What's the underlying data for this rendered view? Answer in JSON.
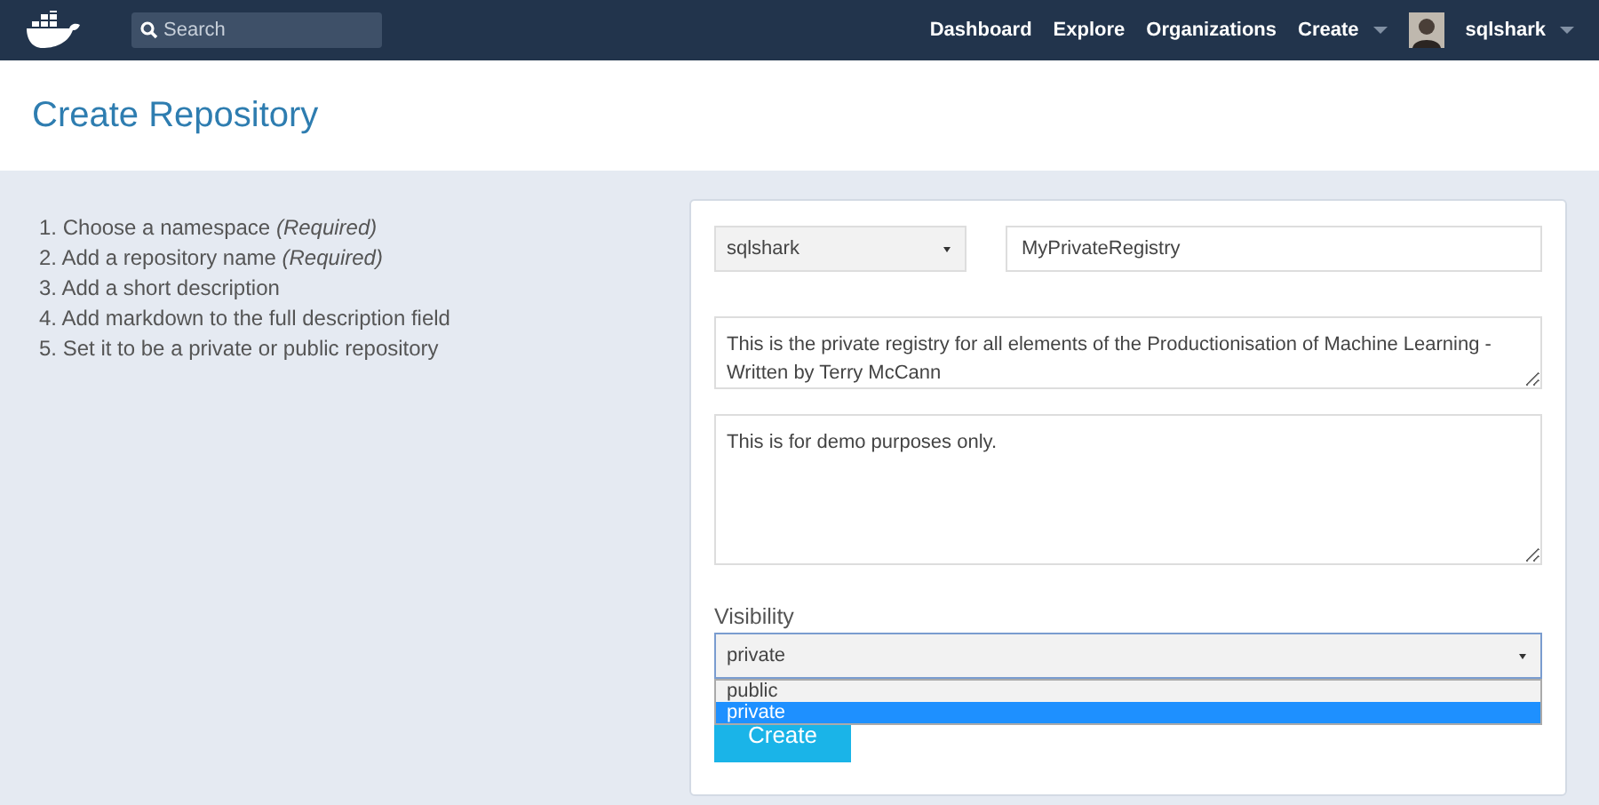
{
  "navbar": {
    "search": {
      "placeholder": "Search"
    },
    "links": [
      "Dashboard",
      "Explore",
      "Organizations"
    ],
    "create_menu": "Create",
    "user": "sqlshark"
  },
  "page_title": "Create Repository",
  "steps": [
    {
      "number": "1.",
      "text": "Choose a namespace",
      "note": "(Required)"
    },
    {
      "number": "2.",
      "text": "Add a repository name",
      "note": "(Required)"
    },
    {
      "number": "3.",
      "text": "Add a short description"
    },
    {
      "number": "4.",
      "text": "Add markdown to the full description field"
    },
    {
      "number": "5.",
      "text": "Set it to be a private or public repository"
    }
  ],
  "form": {
    "namespace": "sqlshark",
    "name": "MyPrivateRegistry",
    "short_description": "This is the private registry for all elements of the Productionisation of Machine Learning - Written by Terry McCann",
    "full_description": "This is for demo purposes only.",
    "visibility_label": "Visibility",
    "visibility": {
      "value": "private",
      "expanded": true,
      "options": [
        {
          "label": "public",
          "selected": false
        },
        {
          "label": "private",
          "selected": true
        }
      ]
    },
    "submit": "Create"
  }
}
